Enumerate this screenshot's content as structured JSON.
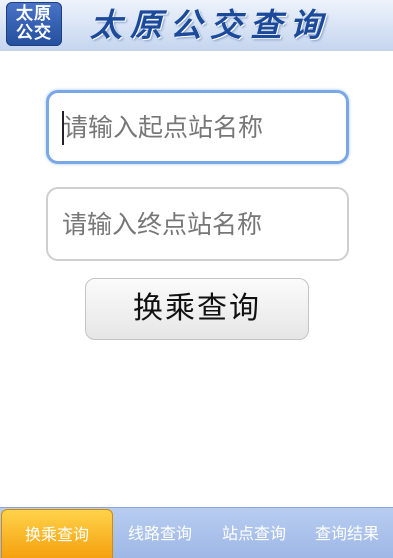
{
  "header": {
    "logo_line1": "太原",
    "logo_line2": "公交",
    "title": "太原公交查询"
  },
  "form": {
    "start_placeholder": "请输入起点站名称",
    "start_value": "",
    "end_placeholder": "请输入终点站名称",
    "end_value": "",
    "submit_label": "换乘查询"
  },
  "bottom_nav": {
    "active_index": 0,
    "tabs": [
      {
        "label": "换乘查询"
      },
      {
        "label": "线路查询"
      },
      {
        "label": "站点查询"
      },
      {
        "label": "查询结果"
      }
    ]
  },
  "colors": {
    "header_title": "#1c4a9a",
    "logo_bg": "#234f9d",
    "focused_border": "#7aa7e6",
    "nav_bg": "#a8c0ea",
    "active_tab": "#f5a00f"
  }
}
